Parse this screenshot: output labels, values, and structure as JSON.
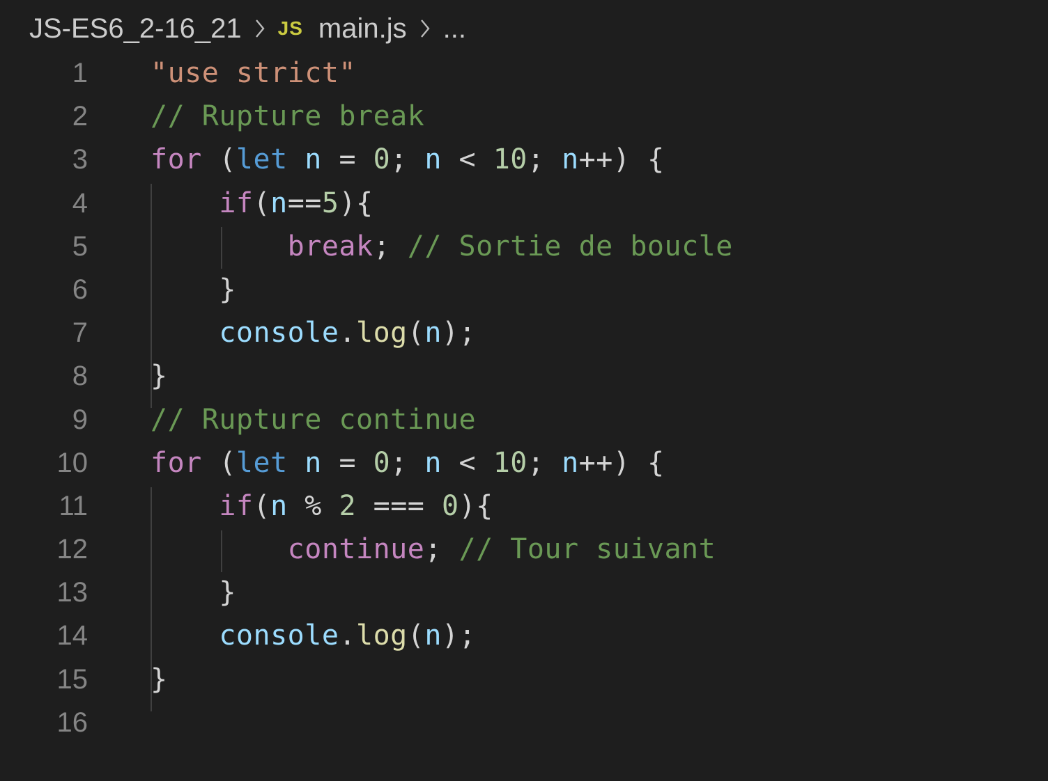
{
  "breadcrumb": {
    "folder": "JS-ES6_2-16_21",
    "file_icon": "JS",
    "file": "main.js",
    "more": "..."
  },
  "colors": {
    "background": "#1e1e1e",
    "string": "#ce9178",
    "comment": "#6a9955",
    "keyword": "#569cd6",
    "control": "#c586c0",
    "variable": "#9cdcfe",
    "number": "#b5cea8",
    "function": "#dcdcaa",
    "punctuation": "#d4d4d4",
    "line_number": "#858585",
    "js_icon": "#cbcb41"
  },
  "lines": [
    {
      "num": "1",
      "tokens": [
        [
          "str",
          "\"use strict\""
        ]
      ]
    },
    {
      "num": "2",
      "tokens": [
        [
          "com",
          "// Rupture break"
        ]
      ]
    },
    {
      "num": "3",
      "tokens": [
        [
          "ctl",
          "for"
        ],
        [
          "pun",
          " ("
        ],
        [
          "kw",
          "let"
        ],
        [
          "pun",
          " "
        ],
        [
          "var",
          "n"
        ],
        [
          "pun",
          " = "
        ],
        [
          "num",
          "0"
        ],
        [
          "pun",
          "; "
        ],
        [
          "var",
          "n"
        ],
        [
          "pun",
          " < "
        ],
        [
          "num",
          "10"
        ],
        [
          "pun",
          "; "
        ],
        [
          "var",
          "n"
        ],
        [
          "pun",
          "++) {"
        ]
      ]
    },
    {
      "num": "4",
      "tokens": [
        [
          "pun",
          "    "
        ],
        [
          "ctl",
          "if"
        ],
        [
          "pun",
          "("
        ],
        [
          "var",
          "n"
        ],
        [
          "pun",
          "=="
        ],
        [
          "num",
          "5"
        ],
        [
          "pun",
          "){"
        ]
      ]
    },
    {
      "num": "5",
      "tokens": [
        [
          "pun",
          "        "
        ],
        [
          "ctl",
          "break"
        ],
        [
          "pun",
          "; "
        ],
        [
          "com",
          "// Sortie de boucle"
        ]
      ]
    },
    {
      "num": "6",
      "tokens": [
        [
          "pun",
          "    }"
        ]
      ]
    },
    {
      "num": "7",
      "tokens": [
        [
          "pun",
          "    "
        ],
        [
          "var",
          "console"
        ],
        [
          "pun",
          "."
        ],
        [
          "fn",
          "log"
        ],
        [
          "pun",
          "("
        ],
        [
          "var",
          "n"
        ],
        [
          "pun",
          ");"
        ]
      ]
    },
    {
      "num": "8",
      "tokens": [
        [
          "pun",
          "}"
        ]
      ]
    },
    {
      "num": "9",
      "tokens": [
        [
          "com",
          "// Rupture continue"
        ]
      ]
    },
    {
      "num": "10",
      "tokens": [
        [
          "ctl",
          "for"
        ],
        [
          "pun",
          " ("
        ],
        [
          "kw",
          "let"
        ],
        [
          "pun",
          " "
        ],
        [
          "var",
          "n"
        ],
        [
          "pun",
          " = "
        ],
        [
          "num",
          "0"
        ],
        [
          "pun",
          "; "
        ],
        [
          "var",
          "n"
        ],
        [
          "pun",
          " < "
        ],
        [
          "num",
          "10"
        ],
        [
          "pun",
          "; "
        ],
        [
          "var",
          "n"
        ],
        [
          "pun",
          "++) {"
        ]
      ]
    },
    {
      "num": "11",
      "tokens": [
        [
          "pun",
          "    "
        ],
        [
          "ctl",
          "if"
        ],
        [
          "pun",
          "("
        ],
        [
          "var",
          "n"
        ],
        [
          "pun",
          " % "
        ],
        [
          "num",
          "2"
        ],
        [
          "pun",
          " === "
        ],
        [
          "num",
          "0"
        ],
        [
          "pun",
          "){"
        ]
      ]
    },
    {
      "num": "12",
      "tokens": [
        [
          "pun",
          "        "
        ],
        [
          "ctl",
          "continue"
        ],
        [
          "pun",
          "; "
        ],
        [
          "com",
          "// Tour suivant"
        ]
      ]
    },
    {
      "num": "13",
      "tokens": [
        [
          "pun",
          "    }"
        ]
      ]
    },
    {
      "num": "14",
      "tokens": [
        [
          "pun",
          "    "
        ],
        [
          "var",
          "console"
        ],
        [
          "pun",
          "."
        ],
        [
          "fn",
          "log"
        ],
        [
          "pun",
          "("
        ],
        [
          "var",
          "n"
        ],
        [
          "pun",
          ");"
        ]
      ]
    },
    {
      "num": "15",
      "tokens": [
        [
          "pun",
          "}"
        ]
      ]
    },
    {
      "num": "16",
      "tokens": []
    }
  ]
}
